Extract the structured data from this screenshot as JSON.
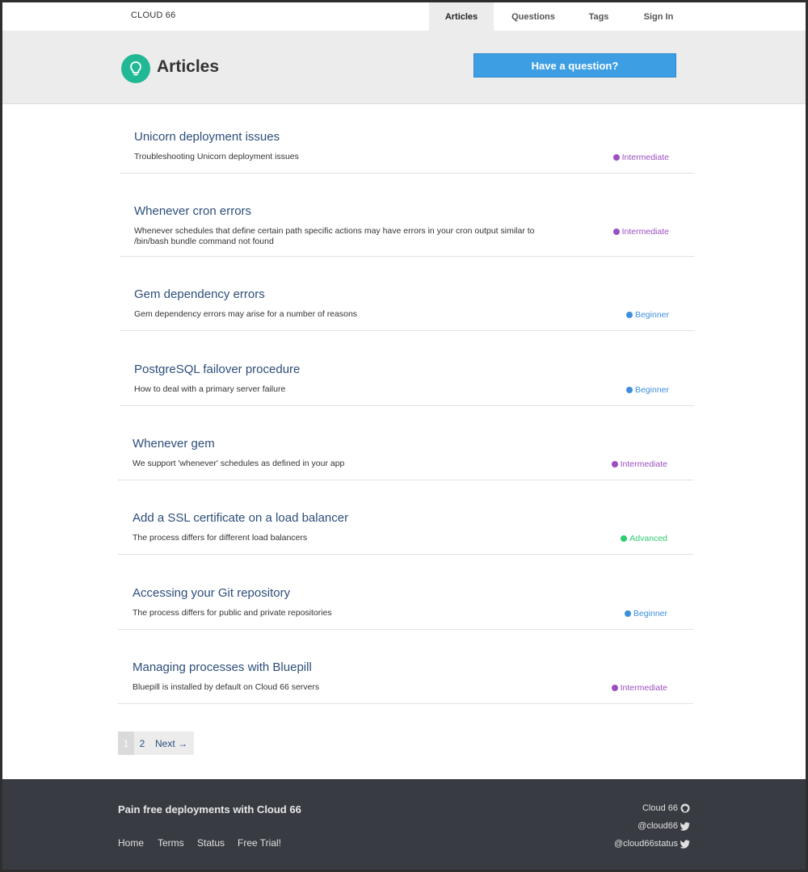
{
  "nav": {
    "brand": "CLOUD 66",
    "items": [
      {
        "label": "Articles",
        "active": true
      },
      {
        "label": "Questions",
        "active": false
      },
      {
        "label": "Tags",
        "active": false
      },
      {
        "label": "Sign In",
        "active": false
      }
    ]
  },
  "header": {
    "title": "Articles",
    "icon": "lightbulb-icon",
    "ask_button": "Have a question?"
  },
  "articles": [
    {
      "title": "Unicorn deployment issues",
      "description": "Troubleshooting Unicorn deployment issues",
      "level": "Intermediate"
    },
    {
      "title": "Whenever cron errors",
      "description": "Whenever schedules that define certain path specific actions may have errors in your cron output similar to /bin/bash bundle command not found",
      "level": "Intermediate"
    },
    {
      "title": "Gem dependency errors",
      "description": "Gem dependency errors may arise for a number of reasons",
      "level": "Beginner"
    },
    {
      "title": "PostgreSQL failover procedure",
      "description": "How to deal with a primary server failure",
      "level": "Beginner"
    },
    {
      "title": "Whenever gem",
      "description": "We support 'whenever' schedules as defined in your app",
      "level": "Intermediate"
    },
    {
      "title": "Add a SSL certificate on a load balancer",
      "description": "The process differs for different load balancers",
      "level": "Advanced"
    },
    {
      "title": "Accessing your Git repository",
      "description": "The process differs for public and private repositories",
      "level": "Beginner"
    },
    {
      "title": "Managing processes with Bluepill",
      "description": "Bluepill is installed by default on Cloud 66 servers",
      "level": "Intermediate"
    }
  ],
  "level_colors": {
    "Intermediate": "#9b4fc0",
    "Beginner": "#3c8fdd",
    "Advanced": "#2ecc71"
  },
  "pagination": {
    "current": "1",
    "pages": [
      "2"
    ],
    "next": "Next →"
  },
  "footer": {
    "tagline": "Pain free deployments with Cloud 66",
    "links": [
      "Home",
      "Terms",
      "Status",
      "Free Trial!"
    ],
    "social": [
      {
        "label": "Cloud 66",
        "icon": "github-icon"
      },
      {
        "label": "@cloud66",
        "icon": "twitter-icon"
      },
      {
        "label": "@cloud66status",
        "icon": "twitter-icon"
      }
    ]
  }
}
